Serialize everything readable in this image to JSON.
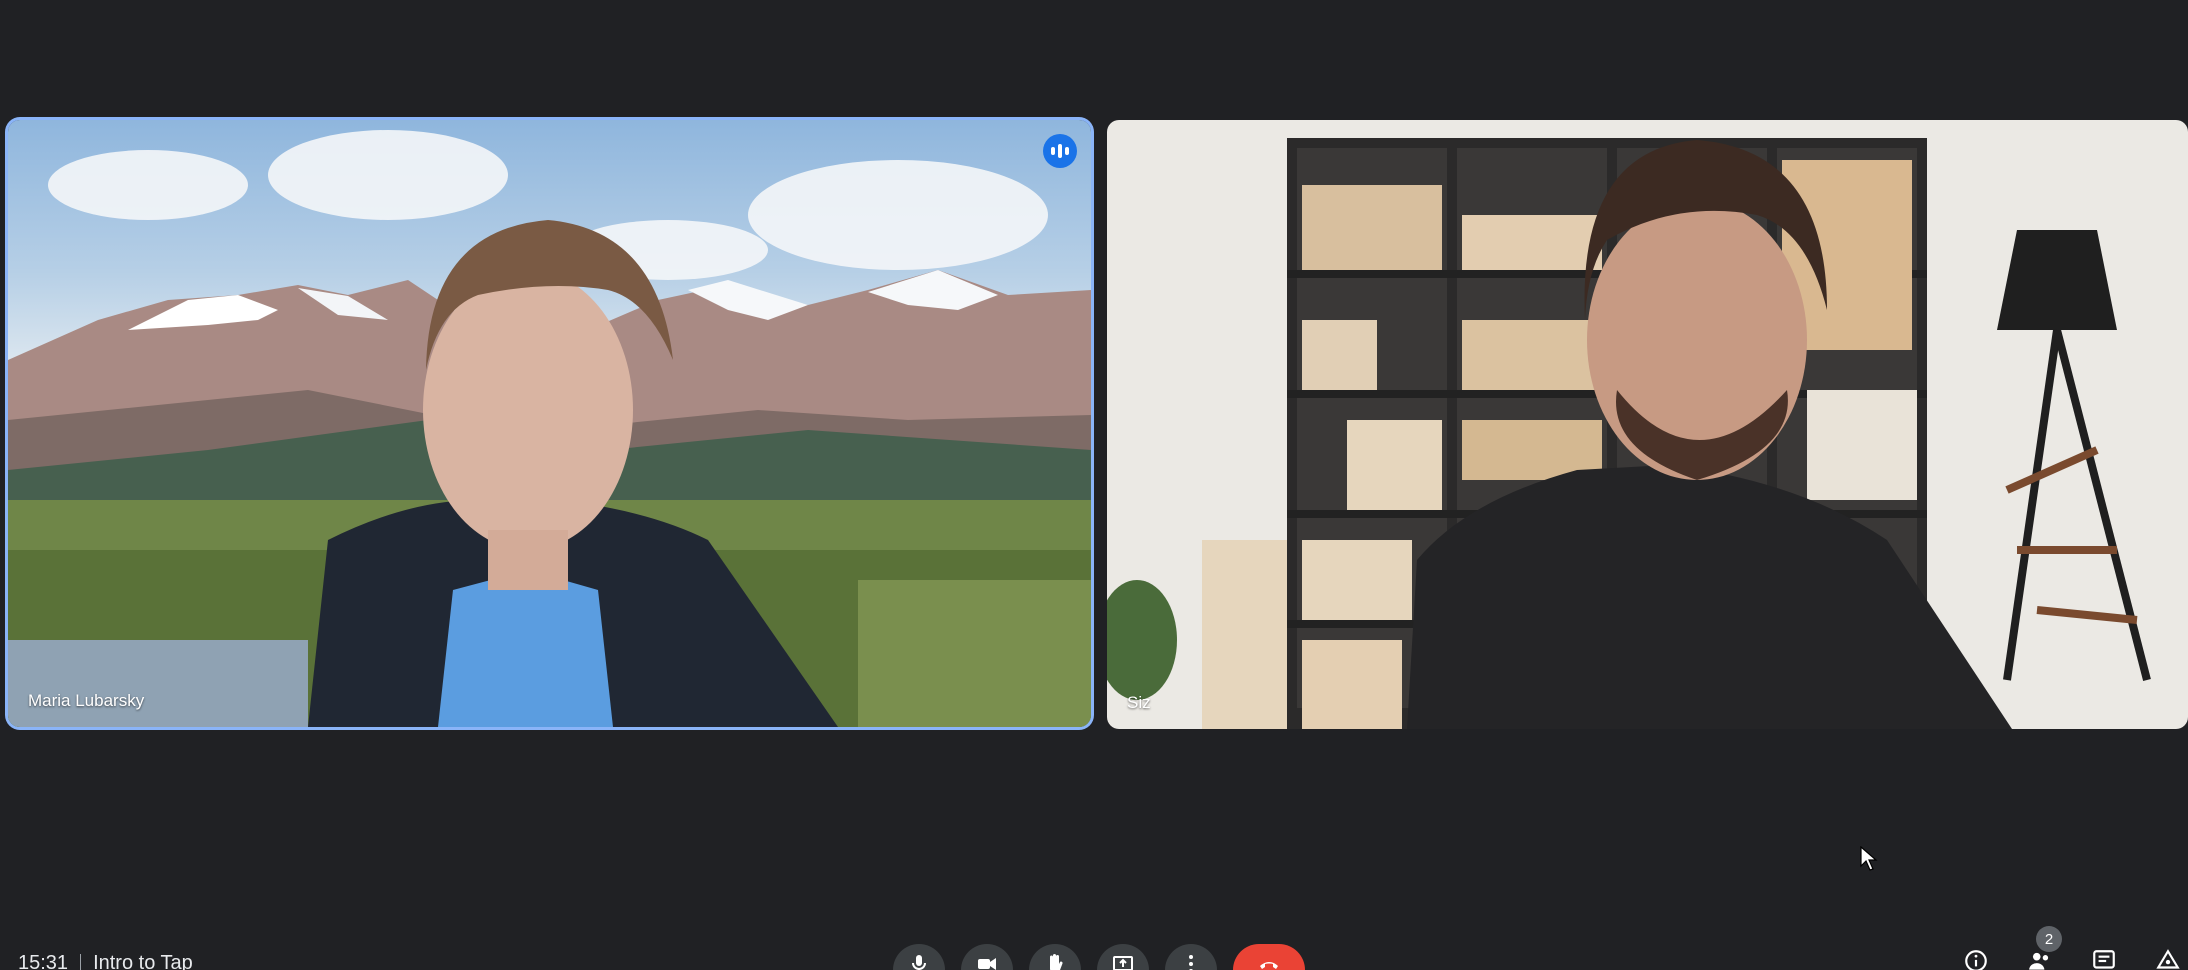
{
  "participants": [
    {
      "name": "Maria Lubarsky",
      "speaking": true
    },
    {
      "name": "Siz"
    }
  ],
  "meeting": {
    "time": "15:31",
    "title": "Intro to Tap"
  },
  "controls": {
    "mic": "mic-icon",
    "camera": "camera-icon",
    "raise_hand": "hand-icon",
    "present": "present-icon",
    "more": "more-vert-icon",
    "end_call": "call-end-icon"
  },
  "right_controls": {
    "people_count": "2"
  },
  "colors": {
    "background": "#202124",
    "active_speaker_border": "#8ab4f8",
    "end_call": "#ea4335",
    "control_bg": "#3c4043"
  }
}
